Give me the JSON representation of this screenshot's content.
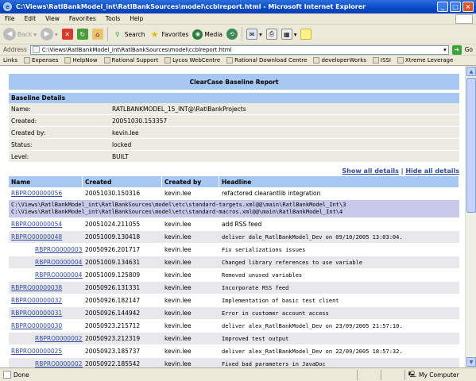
{
  "window": {
    "title": "C:\\Views\\RatlBankModel_int\\RatlBankSources\\model\\ccblreport.html - Microsoft Internet Explorer"
  },
  "menu": [
    "File",
    "Edit",
    "View",
    "Favorites",
    "Tools",
    "Help"
  ],
  "toolbar": {
    "back": "Back",
    "search": "Search",
    "favorites": "Favorites",
    "media": "Media"
  },
  "address": {
    "label": "Address",
    "value": "C:\\Views\\RatlBankModel_int\\RatlBankSources\\model\\ccblreport.html",
    "go": "Go"
  },
  "links": {
    "label": "Links",
    "items": [
      "Expenses",
      "HelpNow",
      "Rational Support",
      "Lycos WebCentre",
      "Rational Download Centre",
      "developerWorks",
      "ISSI",
      "Xtreme Leverage"
    ]
  },
  "report": {
    "title": "ClearCase Baseline Report",
    "baseline_section": "Baseline Details",
    "details": [
      {
        "key": "Name:",
        "value": "RATLBANKMODEL_15_INT@\\RatlBankProjects"
      },
      {
        "key": "Created:",
        "value": "20051030.153357"
      },
      {
        "key": "Created by:",
        "value": "kevin.lee"
      },
      {
        "key": "Status:",
        "value": "locked"
      },
      {
        "key": "Level:",
        "value": "BUILT"
      }
    ],
    "show_all": "Show all details",
    "hide_all": "Hide all details",
    "columns": [
      "Name",
      "Created",
      "Created by",
      "Headline"
    ],
    "rows": [
      {
        "name": "RBPRO00000056",
        "created": "20051030.150316",
        "by": "kevin.lee",
        "headline": "refactored clearantlib integration",
        "indent": false,
        "bg": "w"
      },
      {
        "name": "RBPRO00000054",
        "created": "20051024.211055",
        "by": "kevin.lee",
        "headline": "add RSS feed",
        "indent": false,
        "bg": "w"
      },
      {
        "name": "RBPRO00000048",
        "created": "20051009.130418",
        "by": "kevin.lee",
        "headline": "deliver dale_RatlBankModel_Dev on 09/10/2005 13:03:04.",
        "indent": false,
        "bg": "g"
      },
      {
        "name": "RBPRO00000036",
        "created": "20050926.201717",
        "by": "kevin.lee",
        "headline": "Fix serializations issues",
        "indent": true,
        "bg": "w"
      },
      {
        "name": "RBPRO00000046",
        "created": "20051009.134631",
        "by": "kevin.lee",
        "headline": "Changed library references to use variable",
        "indent": true,
        "bg": "g"
      },
      {
        "name": "RBPRO00000047",
        "created": "20051009.125809",
        "by": "kevin.lee",
        "headline": "Removed unused variables",
        "indent": true,
        "bg": "w"
      },
      {
        "name": "RBPRO00000038",
        "created": "20050926.131331",
        "by": "kevin.lee",
        "headline": "Incorporate RSS feed",
        "indent": false,
        "bg": "g"
      },
      {
        "name": "RBPRO00000032",
        "created": "20050926.182147",
        "by": "kevin.lee",
        "headline": "Implementation of basic test client",
        "indent": false,
        "bg": "w"
      },
      {
        "name": "RBPRO00000031",
        "created": "20050926.144942",
        "by": "kevin.lee",
        "headline": "Error in customer account access",
        "indent": false,
        "bg": "g"
      },
      {
        "name": "RBPRO00000030",
        "created": "20050923.215712",
        "by": "kevin.lee",
        "headline": "deliver alex_RatlBankModel_Dev on 23/09/2005 21:57:10.",
        "indent": false,
        "bg": "w"
      },
      {
        "name": "RBPRO00000027",
        "created": "20050923.212319",
        "by": "kevin.lee",
        "headline": "Improved test output",
        "indent": true,
        "bg": "g"
      },
      {
        "name": "RBPRO00000025",
        "created": "20050923.185737",
        "by": "kevin.lee",
        "headline": "deliver alex_RatlBankModel_Dev on 22/09/2005 18:57:32.",
        "indent": false,
        "bg": "w"
      },
      {
        "name": "RBPRO00000024",
        "created": "20050922.185542",
        "by": "kevin.lee",
        "headline": "Fixed bad parameters in JavaDoc",
        "indent": true,
        "bg": "g"
      }
    ],
    "files": [
      "C:\\Views\\RatlBankModel_int\\RatlBankSources\\model\\etc\\standard-targets.xml@@\\main\\RatlBankModel_Int\\3",
      "C:\\Views\\RatlBankModel_int\\RatlBankSources\\model\\etc\\standard-macros.xml@@\\main\\RatlBankModel_Int\\4"
    ]
  },
  "status": {
    "text": "Done",
    "zone": "My Computer"
  }
}
